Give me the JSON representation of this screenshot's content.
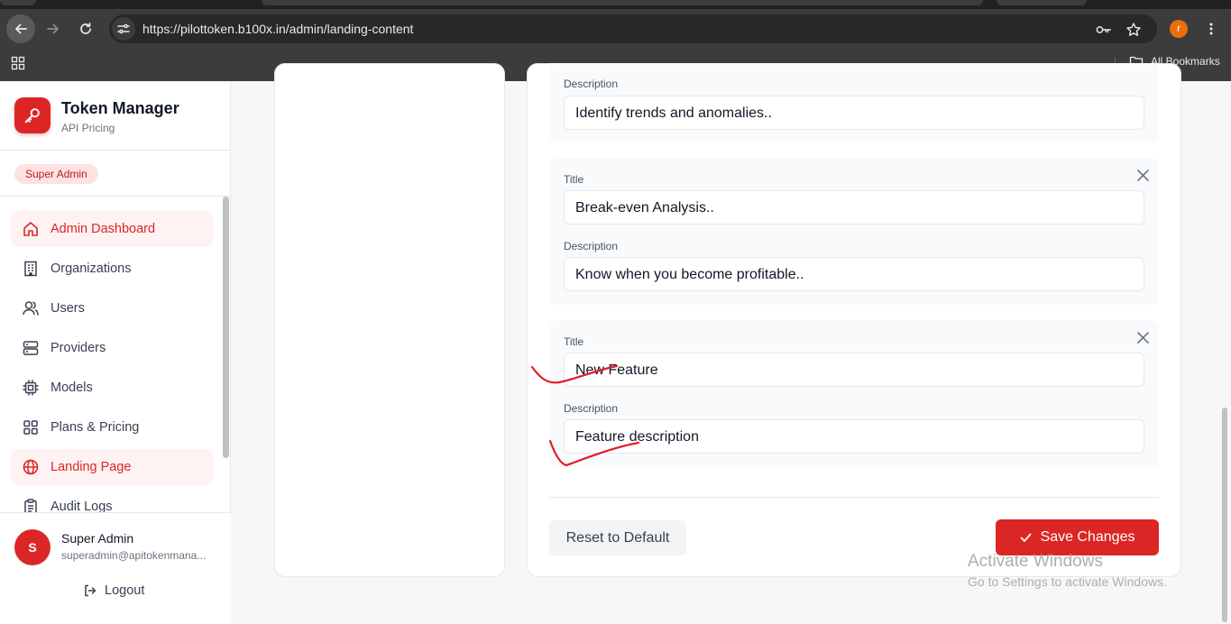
{
  "browser": {
    "url": "https://pilottoken.b100x.in/admin/landing-content",
    "profile_initial": "r",
    "bookmarks_label": "All Bookmarks"
  },
  "sidebar": {
    "brand_title": "Token Manager",
    "brand_subtitle": "API Pricing",
    "role_badge": "Super Admin",
    "items": [
      {
        "label": "Admin Dashboard",
        "icon": "home-icon"
      },
      {
        "label": "Organizations",
        "icon": "building-icon"
      },
      {
        "label": "Users",
        "icon": "users-icon"
      },
      {
        "label": "Providers",
        "icon": "server-icon"
      },
      {
        "label": "Models",
        "icon": "cpu-icon"
      },
      {
        "label": "Plans & Pricing",
        "icon": "grid-icon"
      },
      {
        "label": "Landing Page",
        "icon": "globe-icon"
      },
      {
        "label": "Audit Logs",
        "icon": "clipboard-icon"
      }
    ],
    "user": {
      "initial": "S",
      "name": "Super Admin",
      "email": "superadmin@apitokenmana..."
    },
    "logout_label": "Logout"
  },
  "features": [
    {
      "description_label": "Description",
      "description": "Identify trends and anomalies.."
    },
    {
      "title_label": "Title",
      "title": "Break-even Analysis..",
      "description_label": "Description",
      "description": "Know when you become profitable.."
    },
    {
      "title_label": "Title",
      "title": "New Feature",
      "description_label": "Description",
      "description": "Feature description"
    }
  ],
  "actions": {
    "reset_label": "Reset to Default",
    "save_label": "Save Changes"
  },
  "watermark": {
    "title": "Activate Windows",
    "subtitle": "Go to Settings to activate Windows."
  },
  "colors": {
    "accent": "#dc2626",
    "annotation": "#e11d2a"
  }
}
